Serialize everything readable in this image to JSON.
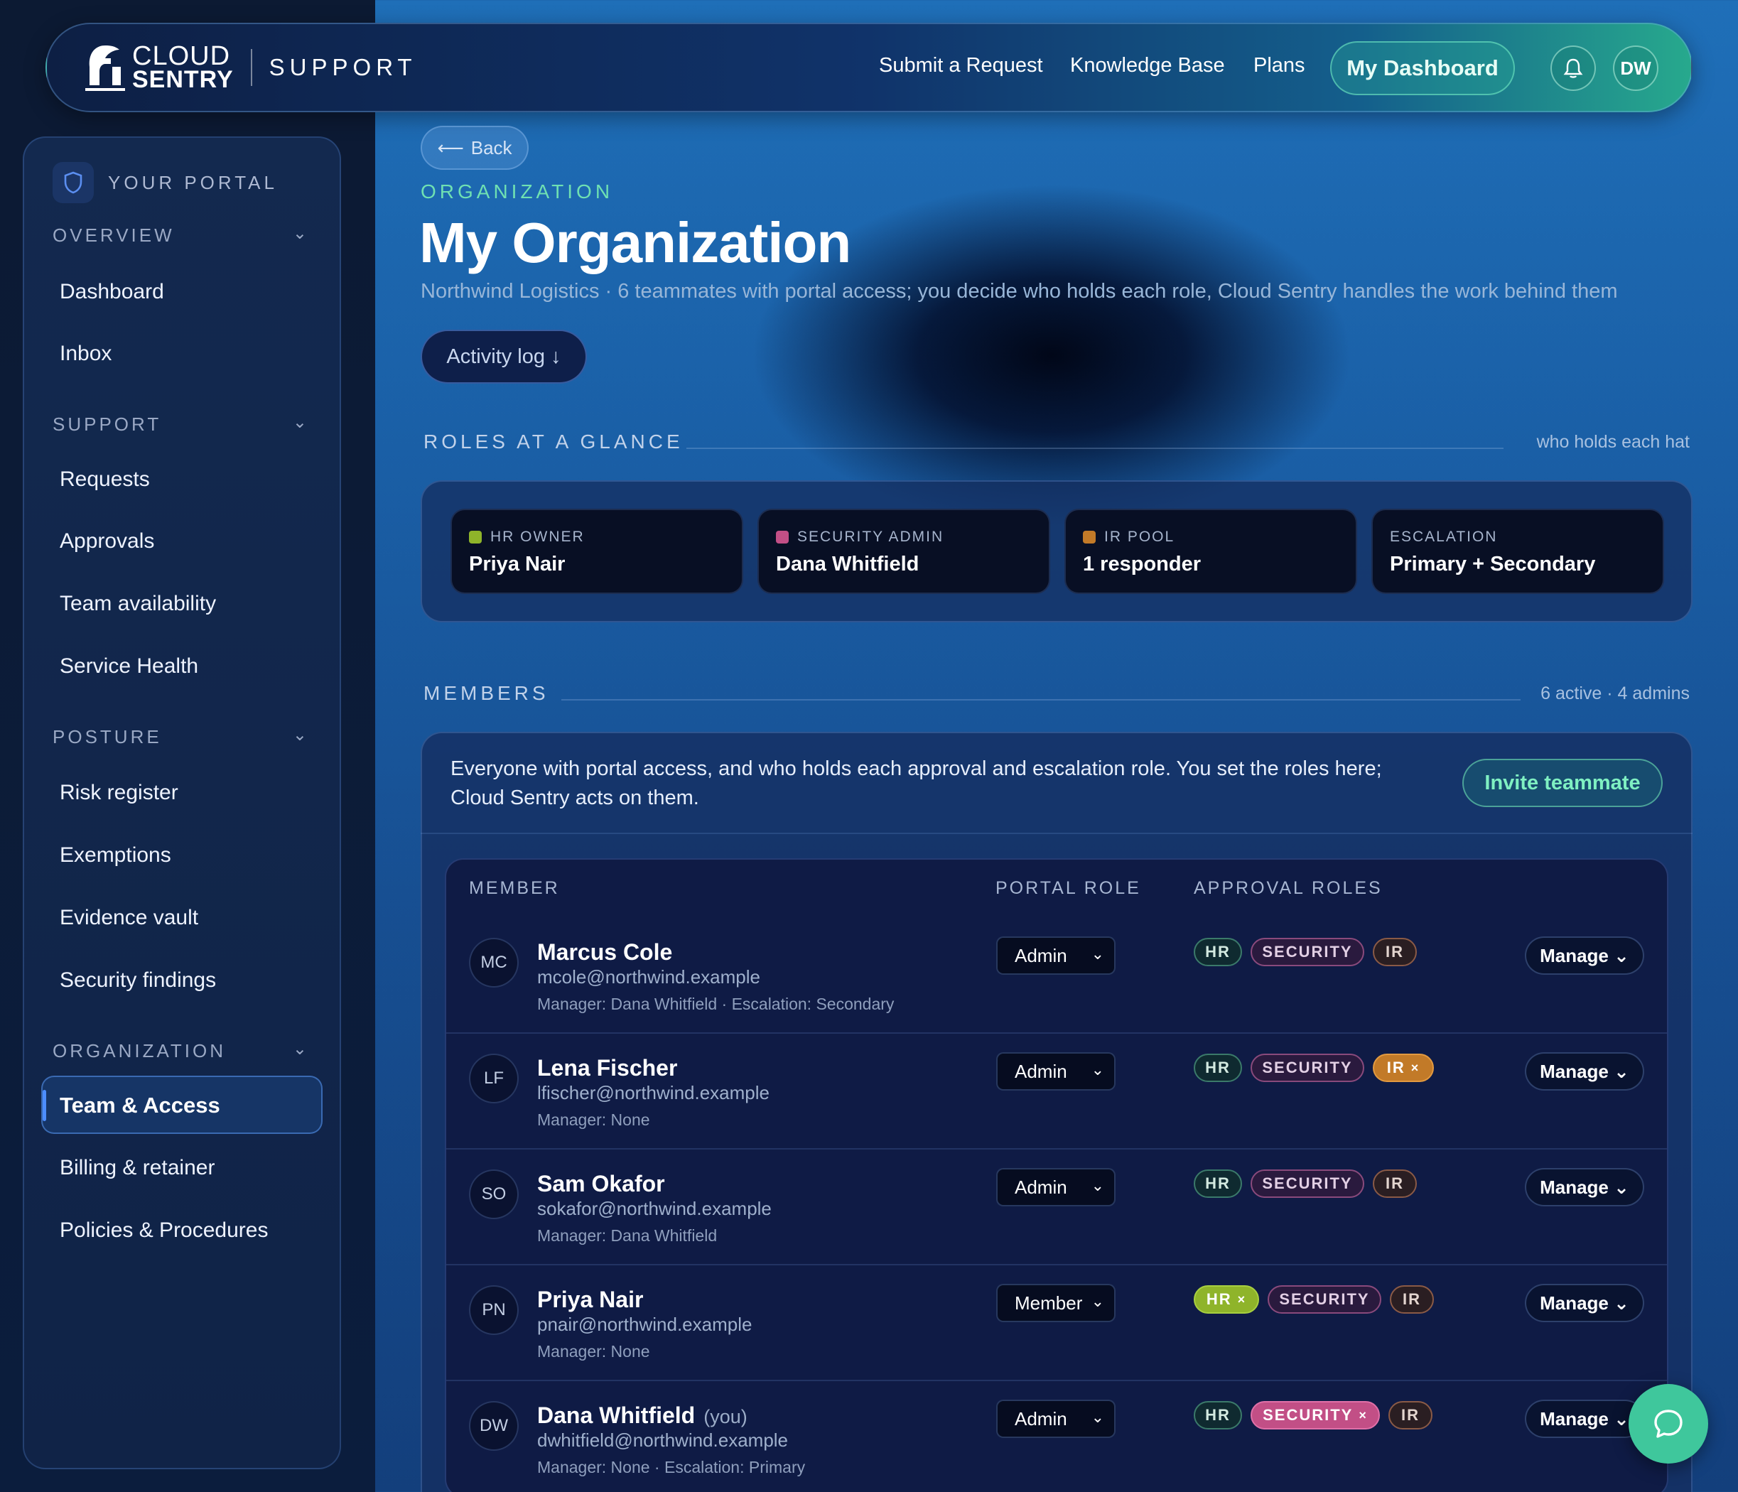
{
  "header": {
    "brand_line1": "CLOUD",
    "brand_line2": "SENTRY",
    "section": "SUPPORT",
    "nav": [
      "Submit a Request",
      "Knowledge Base",
      "Plans"
    ],
    "dashboard_label": "My Dashboard",
    "avatar": "DW"
  },
  "sidebar": {
    "title": "YOUR PORTAL",
    "sections": [
      {
        "label": "OVERVIEW",
        "items": [
          "Dashboard",
          "Inbox"
        ]
      },
      {
        "label": "SUPPORT",
        "items": [
          "Requests",
          "Approvals",
          "Team availability",
          "Service Health"
        ]
      },
      {
        "label": "POSTURE",
        "items": [
          "Risk register",
          "Exemptions",
          "Evidence vault",
          "Security findings"
        ]
      },
      {
        "label": "ORGANIZATION",
        "items": [
          "Team & Access",
          "Billing & retainer",
          "Policies & Procedures"
        ]
      }
    ],
    "active_item": "Team & Access"
  },
  "page": {
    "back_label": "Back",
    "eyebrow": "ORGANIZATION",
    "title": "My Organization",
    "subtitle": "Northwind Logistics · 6 teammates with portal access; you decide who holds each role, Cloud Sentry handles the work behind them",
    "activity_label": "Activity log ↓"
  },
  "roles": {
    "title": "ROLES AT A GLANCE",
    "hint": "who holds each hat",
    "cards": [
      {
        "label": "HR OWNER",
        "value": "Priya Nair",
        "color": "#8fb42a"
      },
      {
        "label": "SECURITY ADMIN",
        "value": "Dana Whitfield",
        "color": "#c24f86"
      },
      {
        "label": "IR POOL",
        "value": "1 responder",
        "color": "#c27a28"
      },
      {
        "label": "ESCALATION",
        "value": "Primary + Secondary",
        "color": ""
      }
    ]
  },
  "members": {
    "title": "MEMBERS",
    "summary": "6 active · 4 admins",
    "description": "Everyone with portal access, and who holds each approval and escalation role. You set the roles here; Cloud Sentry acts on them.",
    "invite_label": "Invite teammate",
    "columns": [
      "MEMBER",
      "PORTAL ROLE",
      "APPROVAL ROLES"
    ],
    "chip_labels": {
      "hr": "HR",
      "security": "SECURITY",
      "ir": "IR",
      "remove": "×"
    },
    "manage_label": "Manage ⌄",
    "rows": [
      {
        "initials": "MC",
        "name": "Marcus Cole",
        "you": "",
        "email": "mcole@northwind.example",
        "meta": "Manager: Dana Whitfield · Escalation: Secondary",
        "role": "Admin",
        "hr": false,
        "security": false,
        "ir": false
      },
      {
        "initials": "LF",
        "name": "Lena Fischer",
        "you": "",
        "email": "lfischer@northwind.example",
        "meta": "Manager: None",
        "role": "Admin",
        "hr": false,
        "security": false,
        "ir": true
      },
      {
        "initials": "SO",
        "name": "Sam Okafor",
        "you": "",
        "email": "sokafor@northwind.example",
        "meta": "Manager: Dana Whitfield",
        "role": "Admin",
        "hr": false,
        "security": false,
        "ir": false
      },
      {
        "initials": "PN",
        "name": "Priya Nair",
        "you": "",
        "email": "pnair@northwind.example",
        "meta": "Manager: None",
        "role": "Member",
        "hr": true,
        "security": false,
        "ir": false
      },
      {
        "initials": "DW",
        "name": "Dana Whitfield",
        "you": "(you)",
        "email": "dwhitfield@northwind.example",
        "meta": "Manager: None · Escalation: Primary",
        "role": "Admin",
        "hr": false,
        "security": true,
        "ir": false
      }
    ]
  }
}
